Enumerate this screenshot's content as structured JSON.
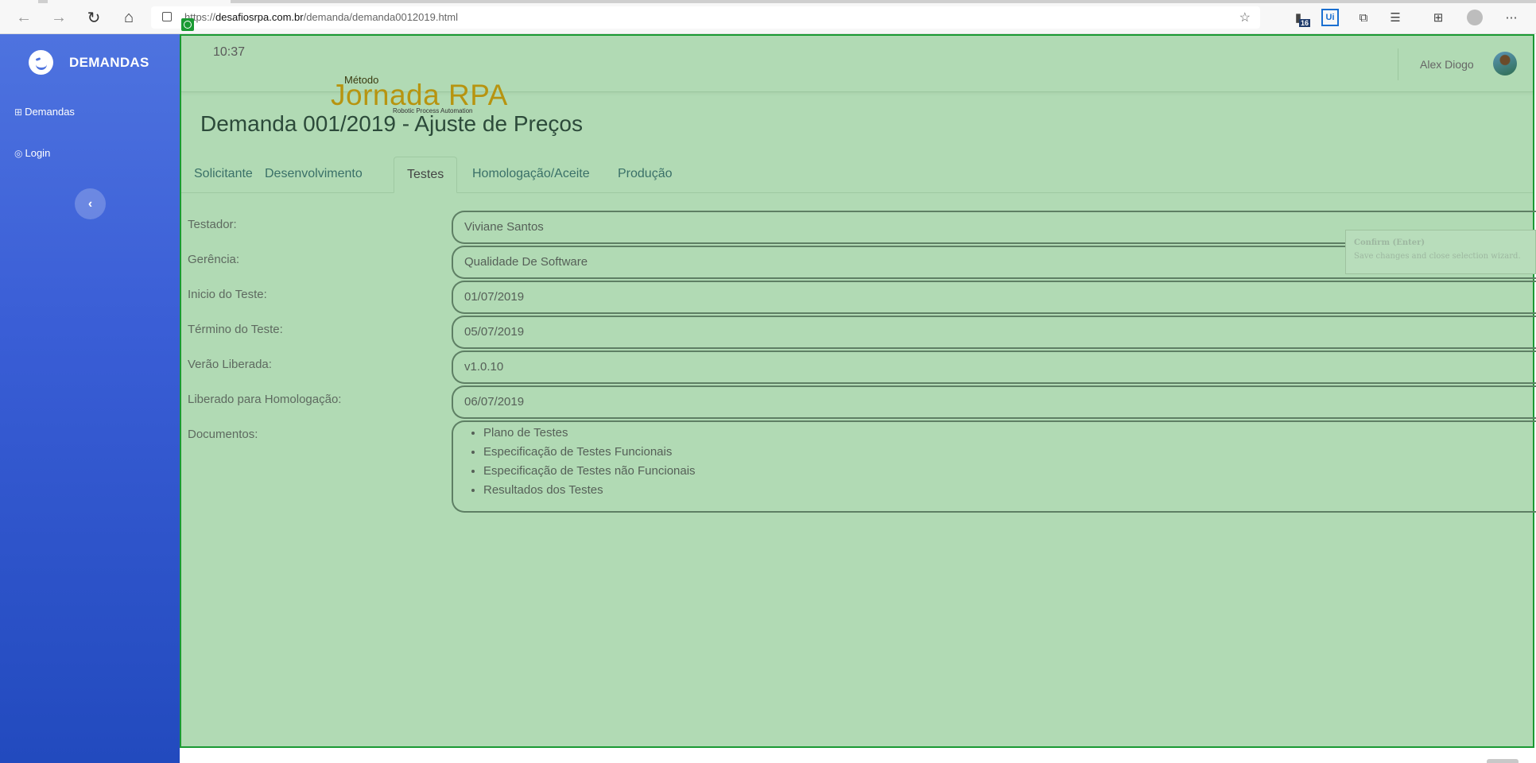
{
  "browser": {
    "url_host": "desafiosrpa.com.br",
    "url_prefix": "https://",
    "url_path": "/demanda/demanda0012019.html",
    "extension_badge": "16",
    "ui_extension_label": "Ui"
  },
  "sidebar": {
    "brand": "DEMANDAS",
    "items": [
      {
        "label": "Demandas",
        "icon": "table-icon"
      },
      {
        "label": "Login",
        "icon": "user-circle-icon"
      }
    ],
    "toggle_label": "‹"
  },
  "topbar": {
    "time": "10:37",
    "user_name": "Alex Diogo"
  },
  "logo": {
    "metodo": "Método",
    "main": "Jornada RPA",
    "subtitle": "Robotic Process Automation"
  },
  "page": {
    "title": "Demanda 001/2019 - Ajuste de Preços"
  },
  "tabs": [
    {
      "label": "Solicitante",
      "active": false
    },
    {
      "label": "Desenvolvimento",
      "active": false
    },
    {
      "label": "Testes",
      "active": true
    },
    {
      "label": "Homologação/Aceite",
      "active": false
    },
    {
      "label": "Produção",
      "active": false
    }
  ],
  "form": {
    "fields": [
      {
        "label": "Testador:",
        "value": "Viviane Santos"
      },
      {
        "label": "Gerência:",
        "value": "Qualidade De Software"
      },
      {
        "label": "Inicio do Teste:",
        "value": "01/07/2019"
      },
      {
        "label": "Término do Teste:",
        "value": "05/07/2019"
      },
      {
        "label": "Verão Liberada:",
        "value": "v1.0.10"
      },
      {
        "label": "Liberado para Homologação:",
        "value": "06/07/2019"
      }
    ],
    "documents_label": "Documentos:",
    "documents": [
      "Plano de Testes",
      "Especificação de Testes Funcionais",
      "Especificação de Testes não Funcionais",
      "Resultados dos Testes"
    ]
  },
  "tooltip": {
    "title": "Confirm (Enter)",
    "description": "Save changes and close selection wizard."
  },
  "colors": {
    "sidebar_top": "#4e73df",
    "sidebar_bottom": "#224abe",
    "overlay_fill": "#b1dab4",
    "overlay_border": "#1a9a33",
    "logo_text": "#b79410",
    "tab_link": "#3a7068"
  }
}
